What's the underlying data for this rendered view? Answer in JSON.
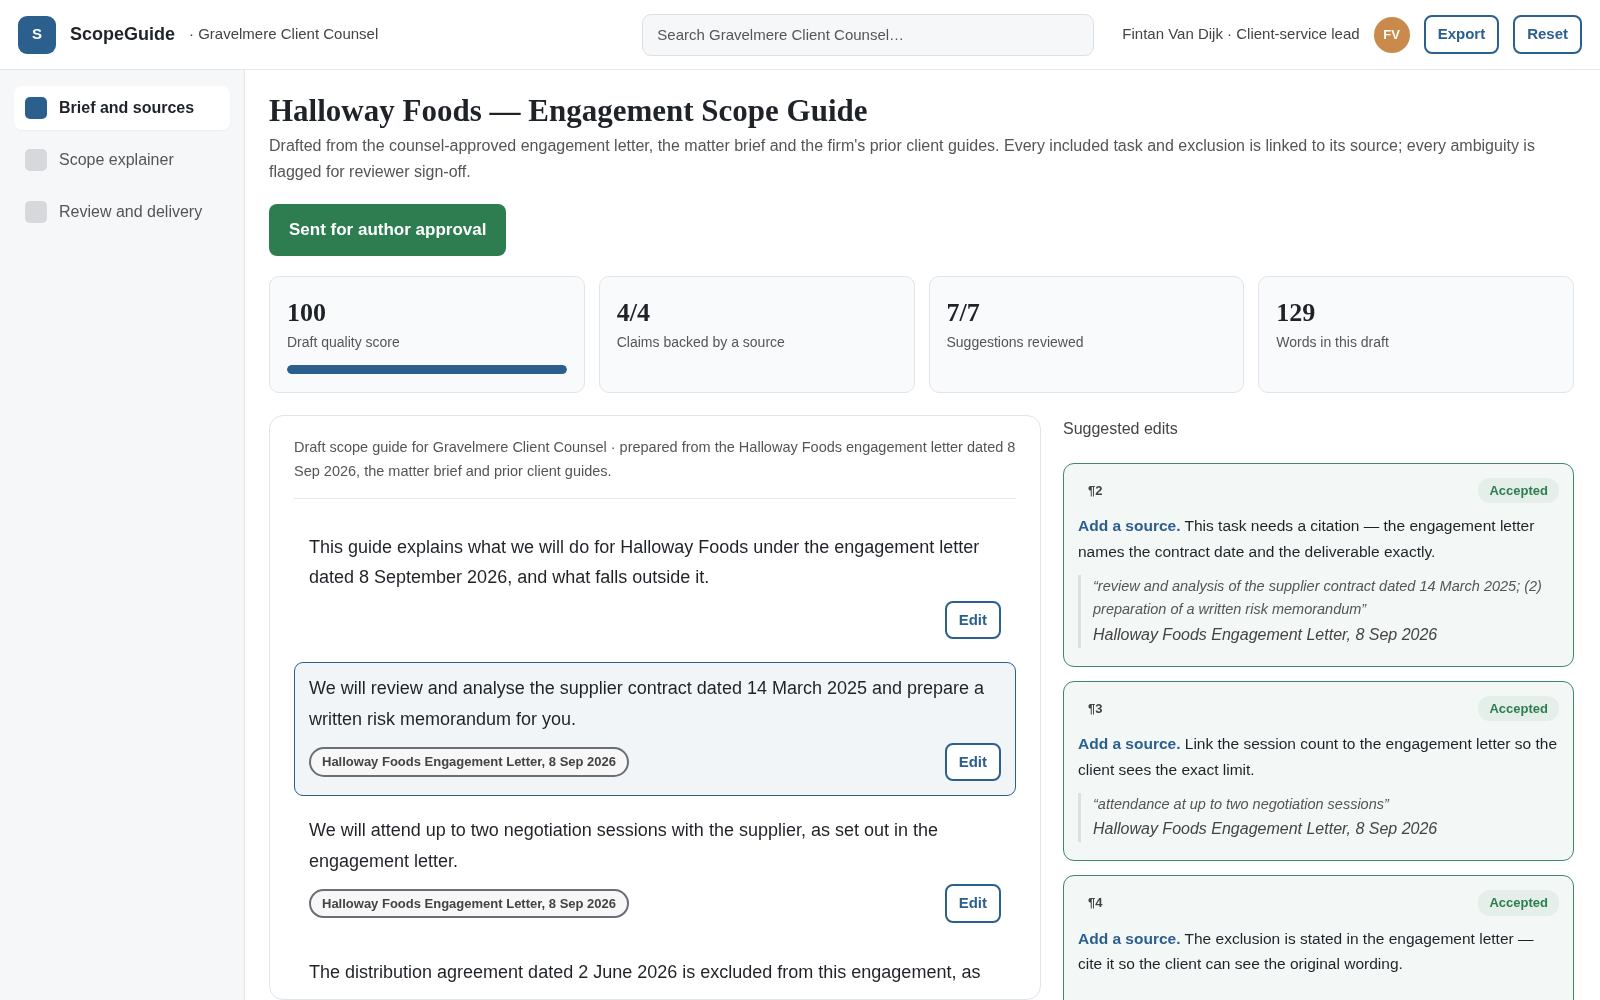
{
  "app": {
    "logo": "S",
    "name": "ScopeGuide",
    "client": "· Gravelmere Client Counsel"
  },
  "search": {
    "placeholder": "Search Gravelmere Client Counsel…"
  },
  "user": {
    "label": "Fintan Van Dijk · Client-service lead",
    "initials": "FV"
  },
  "header_buttons": [
    "Export",
    "Reset"
  ],
  "sidebar": {
    "items": [
      {
        "label": "Brief and sources",
        "selected": true
      },
      {
        "label": "Scope explainer",
        "selected": false
      },
      {
        "label": "Review and delivery",
        "selected": false
      }
    ]
  },
  "page": {
    "title": "Halloway Foods — Engagement Scope Guide",
    "description": "Drafted from the counsel-approved engagement letter, the matter brief and the firm's prior client guides. Every included task and exclusion is linked to its source; every ambiguity is flagged for reviewer sign-off.",
    "status_button": "Sent for author approval"
  },
  "stats": [
    {
      "value": "100",
      "label": "Draft quality score",
      "level": 1.0
    },
    {
      "value": "4/4",
      "label": "Claims backed by a source"
    },
    {
      "value": "7/7",
      "label": "Suggestions reviewed"
    },
    {
      "value": "129",
      "label": "Words in this draft"
    }
  ],
  "draft": {
    "intro": "Draft scope guide for Gravelmere Client Counsel · prepared from the Halloway Foods engagement letter dated 8 Sep 2026, the matter brief and prior client guides.",
    "paragraphs": [
      {
        "text": "This guide explains what we will do for Halloway Foods under the engagement letter dated 8 September 2026, and what falls outside it.",
        "selected": false,
        "edit": "Edit"
      },
      {
        "text": "We will review and analyse the supplier contract dated 14 March 2025 and prepare a written risk memorandum for you.",
        "selected": true,
        "source": "Halloway Foods Engagement Letter, 8 Sep 2026",
        "edit": "Edit"
      },
      {
        "text": "We will attend up to two negotiation sessions with the supplier, as set out in the engagement letter.",
        "selected": false,
        "source": "Halloway Foods Engagement Letter, 8 Sep 2026",
        "edit": "Edit"
      },
      {
        "text": "The distribution agreement dated 2 June 2026 is excluded from this engagement, as",
        "selected": false
      }
    ]
  },
  "suggestions": {
    "title": "Suggested edits",
    "items": [
      {
        "para": "¶2",
        "status": "Accepted",
        "text": "**Add a source.** This task needs a citation — the engagement letter names the contract date and the deliverable exactly.",
        "quote": "“review and analysis of the supplier contract dated 14 March 2025; (2) preparation of a written risk memorandum”",
        "citation": "Halloway Foods Engagement Letter, 8 Sep 2026"
      },
      {
        "para": "¶3",
        "status": "Accepted",
        "text": "**Add a source.** Link the session count to the engagement letter so the client sees the exact limit.",
        "quote": "“attendance at up to two negotiation sessions”",
        "citation": "Halloway Foods Engagement Letter, 8 Sep 2026"
      },
      {
        "para": "¶4",
        "status": "Accepted",
        "text": "**Add a source.** The exclusion is stated in the engagement letter — cite it so the client can see the original wording."
      }
    ]
  }
}
